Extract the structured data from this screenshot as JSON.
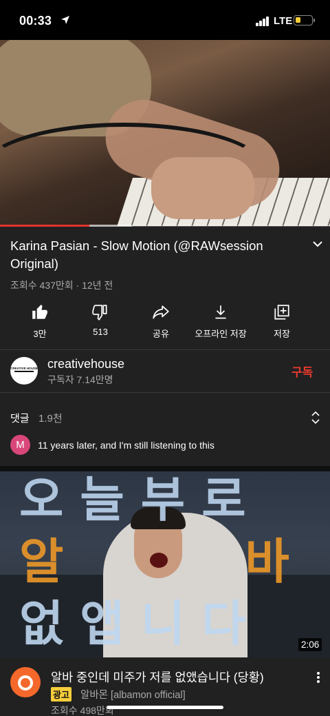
{
  "status_bar": {
    "time": "00:33",
    "network": "LTE",
    "battery_level": 0.3,
    "icons": [
      "location-arrow-icon",
      "signal-icon",
      "battery-icon"
    ]
  },
  "player": {
    "progress_played": 0.27,
    "progress_buffered": 0.4
  },
  "video": {
    "title": "Karina Pasian - Slow Motion (@RAWsession Original)",
    "meta": "조회수 437만회 · 12년 전"
  },
  "actions": {
    "like": "3만",
    "dislike": "513",
    "share": "공유",
    "download": "오프라인 저장",
    "save": "저장"
  },
  "channel": {
    "name": "creativehouse",
    "subscribers": "구독자 7.14만명",
    "subscribe_label": "구독",
    "logo_text": "CREATIVE HOUSE"
  },
  "comments": {
    "label": "댓글",
    "count": "1.9천",
    "top_comment_avatar": "M",
    "top_comment": "11 years later, and I'm still listening to this"
  },
  "ad": {
    "thumbnail_text_line1": "오늘부로",
    "thumbnail_text_line2a": "알",
    "thumbnail_text_line2b": "바",
    "thumbnail_text_line3": "없앱니다",
    "duration": "2:06",
    "title": "알바 중인데 미주가 저를 없앴습니다 (당황)",
    "badge": "광고",
    "channel": "알바몬 [albamon official]",
    "views": "조회수 498만회"
  },
  "colors": {
    "background": "#212121",
    "accent_red": "#e53a2f",
    "ad_badge": "#f6cd3b",
    "albamon_orange": "#f4682b"
  }
}
